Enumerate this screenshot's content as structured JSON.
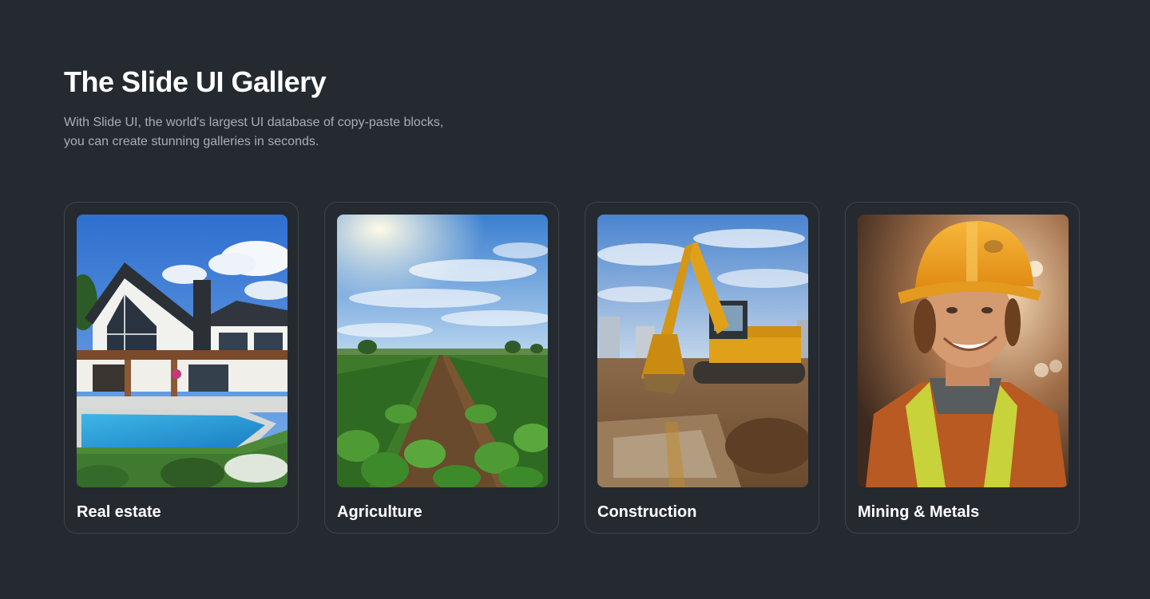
{
  "header": {
    "title": "The Slide UI Gallery",
    "subtitle": "With Slide UI, the world's largest UI database of copy-paste blocks, you can create stunning galleries in seconds."
  },
  "cards": [
    {
      "label": "Real estate",
      "image": "modern-house-with-pool-photo"
    },
    {
      "label": "Agriculture",
      "image": "crop-field-under-sky-photo"
    },
    {
      "label": "Construction",
      "image": "excavator-on-site-photo"
    },
    {
      "label": "Mining & Metals",
      "image": "smiling-worker-hard-hat-photo"
    }
  ],
  "colors": {
    "background": "#252a31",
    "card_border": "#3c424b",
    "title": "#ffffff",
    "subtitle": "#a9aeb6"
  }
}
